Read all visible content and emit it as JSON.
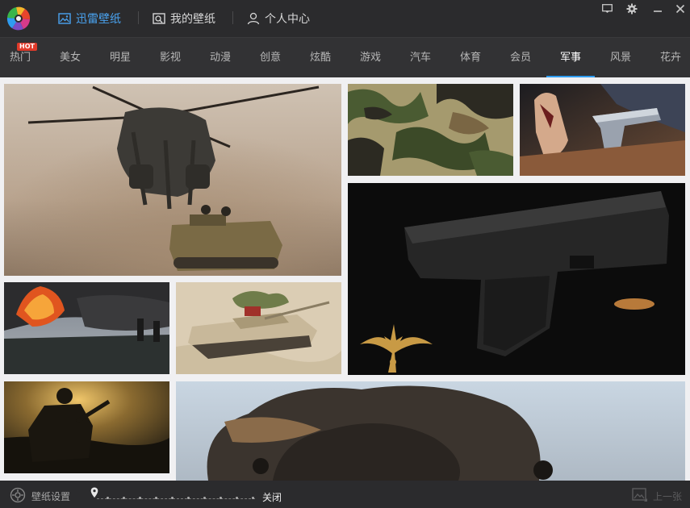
{
  "header": {
    "tabs": [
      {
        "label": "迅雷壁纸",
        "icon": "image-icon",
        "active": true
      },
      {
        "label": "我的壁纸",
        "icon": "my-wallpaper-icon",
        "active": false
      },
      {
        "label": "个人中心",
        "icon": "user-icon",
        "active": false
      }
    ],
    "window_controls": [
      "feedback-icon",
      "gear-icon",
      "minimize-icon",
      "close-icon"
    ]
  },
  "categories": {
    "items": [
      "热门",
      "美女",
      "明星",
      "影视",
      "动漫",
      "创意",
      "炫酷",
      "游戏",
      "汽车",
      "体育",
      "会员",
      "军事",
      "风景",
      "花卉"
    ],
    "active": "军事",
    "hot_badge": "HOT"
  },
  "gallery": {
    "tiles": [
      "helicopter-lifting-armored-vehicle",
      "woodland-camouflage-pattern",
      "luger-pistol-on-magazine",
      "black-pistol-with-navy-seal-trident",
      "oil-fire-smoke-with-soldiers",
      "desert-tank",
      "soldier-silhouette-at-sunset",
      "soldiers-in-battle-smoke"
    ]
  },
  "footer": {
    "settings_label": "壁纸设置",
    "slider_end_label": "关闭",
    "prev_label": "上一张"
  },
  "colors": {
    "accent": "#2f9cf0",
    "active_tab": "#4aa3f0",
    "hot_badge": "#e03a2a",
    "background": "#2b2b2d",
    "grid_background": "#f0f0f2"
  }
}
